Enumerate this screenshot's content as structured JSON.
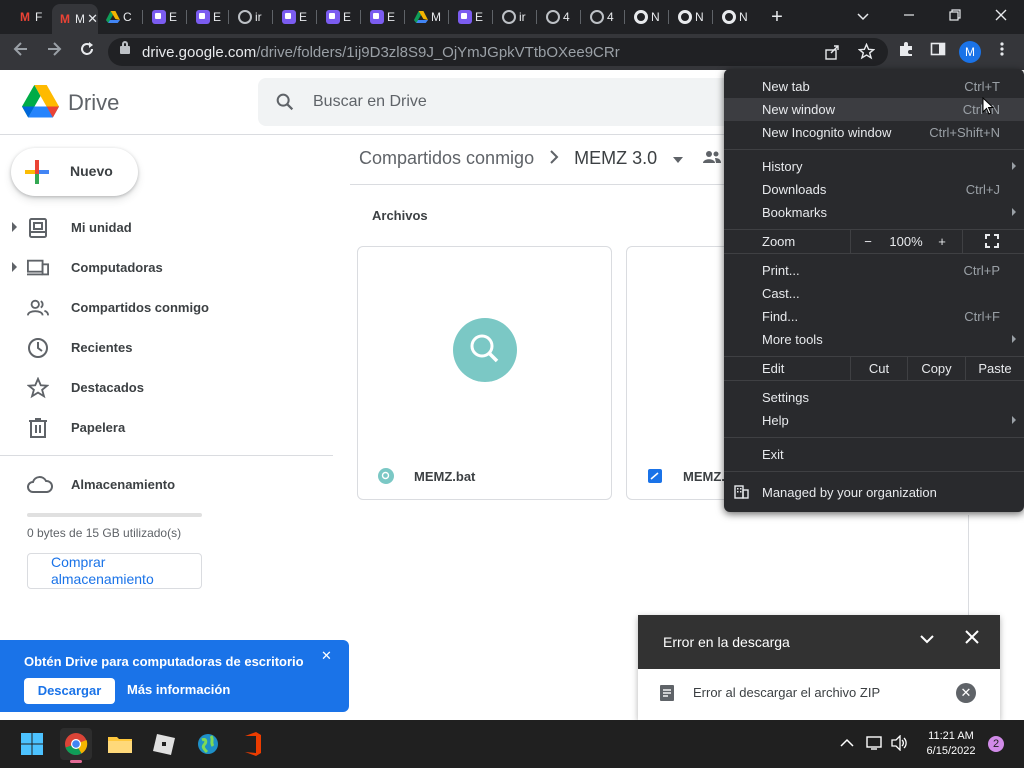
{
  "browser": {
    "tabs": [
      {
        "icon": "gmail-icon",
        "title": "F"
      },
      {
        "icon": "gmail-icon",
        "title": "M",
        "active": true
      },
      {
        "icon": "drive-icon",
        "title": "C"
      },
      {
        "icon": "chat-icon",
        "title": "E"
      },
      {
        "icon": "chat-icon",
        "title": "E"
      },
      {
        "icon": "globe-icon",
        "title": "ir"
      },
      {
        "icon": "chat-icon",
        "title": "E"
      },
      {
        "icon": "chat-icon",
        "title": "E"
      },
      {
        "icon": "chat-icon",
        "title": "E"
      },
      {
        "icon": "drive-icon",
        "title": "M"
      },
      {
        "icon": "chat-icon",
        "title": "E"
      },
      {
        "icon": "globe-icon",
        "title": "ir"
      },
      {
        "icon": "globe-icon",
        "title": "4"
      },
      {
        "icon": "globe-icon",
        "title": "4"
      },
      {
        "icon": "chrome-icon",
        "title": "N"
      },
      {
        "icon": "chrome-icon",
        "title": "N"
      },
      {
        "icon": "chrome-icon",
        "title": "N"
      }
    ],
    "new_tab_label": "+",
    "url_host": "drive.google.com",
    "url_path": "/drive/folders/1ij9D3zl8S9J_OjYmJGpkVTtbOXee9CRr",
    "profile_initial": "M"
  },
  "drive": {
    "app_name": "Drive",
    "search_placeholder": "Buscar en Drive",
    "new_button": "Nuevo",
    "nav": [
      {
        "label": "Mi unidad",
        "icon": "my-drive-icon",
        "expandable": true
      },
      {
        "label": "Computadoras",
        "icon": "computers-icon",
        "expandable": true
      },
      {
        "label": "Compartidos conmigo",
        "icon": "shared-icon",
        "expandable": false
      },
      {
        "label": "Recientes",
        "icon": "clock-icon",
        "expandable": false
      },
      {
        "label": "Destacados",
        "icon": "star-icon",
        "expandable": false
      },
      {
        "label": "Papelera",
        "icon": "trash-icon",
        "expandable": false
      }
    ],
    "storage_label": "Almacenamiento",
    "storage_used_fraction": 0.0,
    "storage_text": "0 bytes de 15 GB utilizado(s)",
    "buy_storage": "Comprar almacenamiento",
    "breadcrumb": [
      "Compartidos conmigo",
      "MEMZ 3.0"
    ],
    "section_label": "Archivos",
    "files": [
      {
        "name": "MEMZ.bat",
        "type": "bat"
      },
      {
        "name": "MEMZ.",
        "type": "exe"
      }
    ],
    "promo": {
      "text": "Obtén Drive para computadoras de escritorio",
      "download": "Descargar",
      "more_info": "Más información"
    },
    "download_panel": {
      "title": "Error en la descarga",
      "error_text": "Error al descargar el archivo ZIP"
    }
  },
  "menu": {
    "items": [
      {
        "label": "New tab",
        "shortcut": "Ctrl+T"
      },
      {
        "label": "New window",
        "shortcut": "Ctrl+N",
        "highlighted": true
      },
      {
        "label": "New Incognito window",
        "shortcut": "Ctrl+Shift+N"
      },
      {
        "label": "History",
        "submenu": true
      },
      {
        "label": "Downloads",
        "shortcut": "Ctrl+J"
      },
      {
        "label": "Bookmarks",
        "submenu": true
      },
      {
        "label": "Print...",
        "shortcut": "Ctrl+P"
      },
      {
        "label": "Cast..."
      },
      {
        "label": "Find...",
        "shortcut": "Ctrl+F"
      },
      {
        "label": "More tools",
        "submenu": true
      },
      {
        "label": "Settings"
      },
      {
        "label": "Help",
        "submenu": true
      },
      {
        "label": "Exit"
      }
    ],
    "zoom": {
      "label": "Zoom",
      "minus": "−",
      "value": "100%",
      "plus": "+"
    },
    "edit": {
      "label": "Edit",
      "cut": "Cut",
      "copy": "Copy",
      "paste": "Paste"
    },
    "managed": "Managed by your organization"
  },
  "taskbar": {
    "time": "11:21 AM",
    "date": "6/15/2022",
    "notifications": "2"
  }
}
